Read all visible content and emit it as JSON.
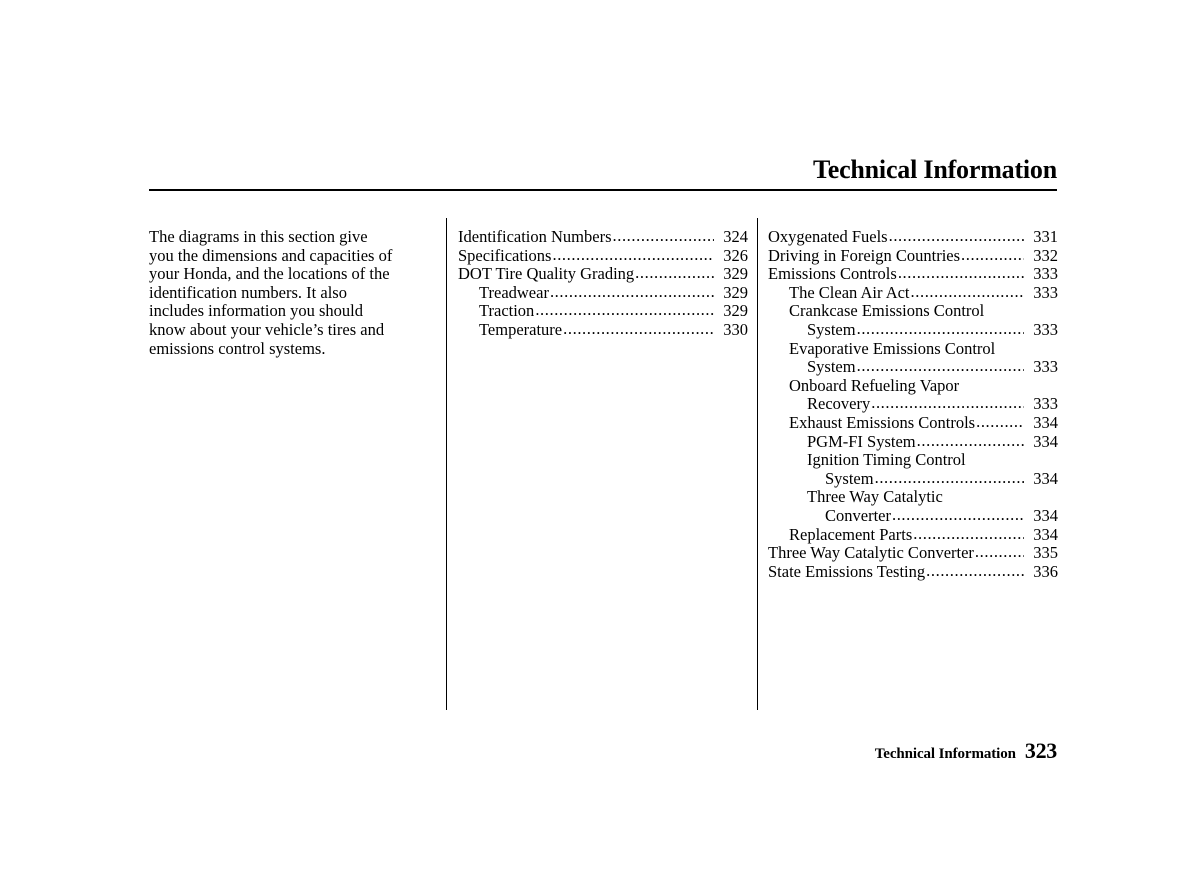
{
  "header": {
    "title": "Technical Information"
  },
  "intro": {
    "lines": [
      "The diagrams in this section give",
      "you the dimensions and capacities of",
      "your Honda, and the locations of the",
      "identification numbers. It also",
      "includes information you should",
      "know about your vehicle’s tires and",
      "emissions control systems."
    ]
  },
  "middle_column": {
    "entries": [
      {
        "label": "Identification Numbers",
        "page": "324",
        "indent": 0,
        "leader": true
      },
      {
        "label": "Specifications ",
        "page": "326",
        "indent": 0,
        "leader": true
      },
      {
        "label": "DOT Tire Quality Grading ",
        "page": "329",
        "indent": 0,
        "leader": true
      },
      {
        "label": "Treadwear ",
        "page": "329",
        "indent": 1,
        "leader": true
      },
      {
        "label": "Traction",
        "page": "329",
        "indent": 1,
        "leader": true
      },
      {
        "label": "Temperature ",
        "page": "330",
        "indent": 1,
        "leader": true
      }
    ]
  },
  "right_column": {
    "entries": [
      {
        "label": "Oxygenated Fuels",
        "page": "331",
        "indent": 0,
        "leader": true
      },
      {
        "label": "Driving in Foreign Countries ",
        "page": "332",
        "indent": 0,
        "leader": true
      },
      {
        "label": "Emissions Controls",
        "page": "333",
        "indent": 0,
        "leader": true
      },
      {
        "label": "The Clean Air Act",
        "page": "333",
        "indent": 1,
        "leader": true
      },
      {
        "label": "Crankcase Emissions Control",
        "page": "",
        "indent": 1,
        "leader": false
      },
      {
        "label": "System",
        "page": "333",
        "indent": 2,
        "leader": true
      },
      {
        "label": "Evaporative Emissions Control",
        "page": "",
        "indent": 1,
        "leader": false
      },
      {
        "label": "System",
        "page": "333",
        "indent": 2,
        "leader": true
      },
      {
        "label": "Onboard Refueling Vapor",
        "page": "",
        "indent": 1,
        "leader": false
      },
      {
        "label": "Recovery ",
        "page": "333",
        "indent": 2,
        "leader": true
      },
      {
        "label": "Exhaust Emissions Controls ",
        "page": "334",
        "indent": 1,
        "leader": true
      },
      {
        "label": "PGM-FI System ",
        "page": "334",
        "indent": 2,
        "leader": true
      },
      {
        "label": "Ignition Timing Control",
        "page": "",
        "indent": 2,
        "leader": false
      },
      {
        "label": "System",
        "page": "334",
        "indent": 3,
        "leader": true
      },
      {
        "label": "Three Way Catalytic",
        "page": "",
        "indent": 2,
        "leader": false
      },
      {
        "label": "Converter",
        "page": "334",
        "indent": 3,
        "leader": true
      },
      {
        "label": "Replacement Parts",
        "page": "334",
        "indent": 1,
        "leader": true
      },
      {
        "label": "Three Way Catalytic Converter",
        "page": "335",
        "indent": 0,
        "leader": true
      },
      {
        "label": "State Emissions Testing ",
        "page": "336",
        "indent": 0,
        "leader": true
      }
    ]
  },
  "footer": {
    "section": "Technical Information",
    "page_number": "323"
  },
  "colors": {
    "background": "#ffffff",
    "text": "#000000",
    "rule": "#000000"
  }
}
